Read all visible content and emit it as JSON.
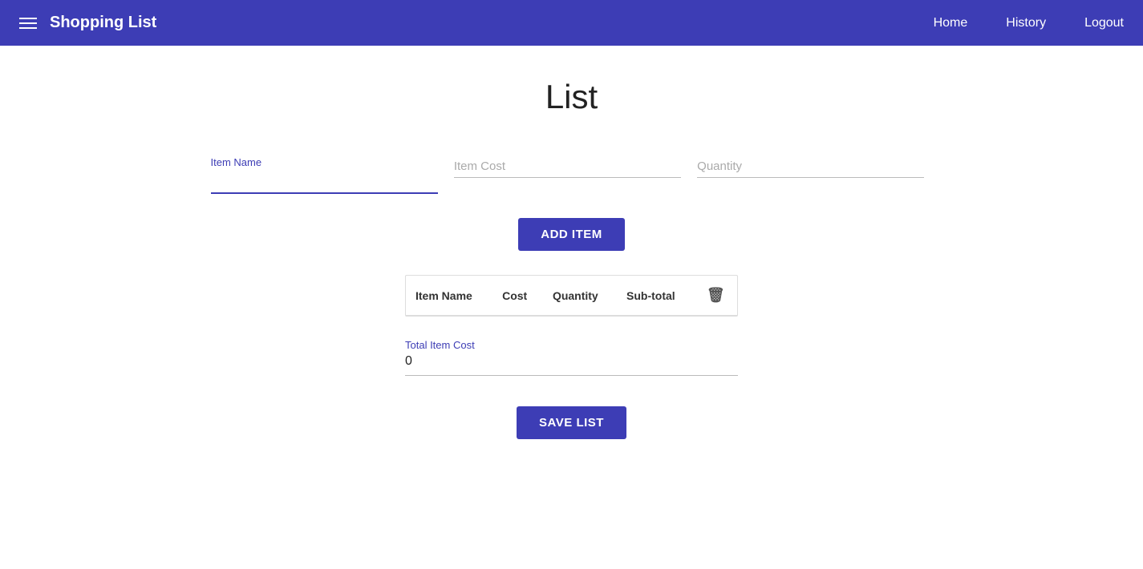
{
  "navbar": {
    "brand": "Shopping List",
    "links": [
      {
        "label": "Home",
        "id": "home"
      },
      {
        "label": "History",
        "id": "history"
      },
      {
        "label": "Logout",
        "id": "logout"
      }
    ]
  },
  "page": {
    "title": "List"
  },
  "form": {
    "item_name_label": "Item Name",
    "item_name_placeholder": "",
    "item_cost_placeholder": "Item Cost",
    "quantity_placeholder": "Quantity",
    "add_item_label": "ADD ITEM"
  },
  "table": {
    "columns": [
      {
        "label": "Item Name",
        "id": "col-item-name"
      },
      {
        "label": "Cost",
        "id": "col-cost"
      },
      {
        "label": "Quantity",
        "id": "col-quantity"
      },
      {
        "label": "Sub-total",
        "id": "col-subtotal"
      }
    ],
    "rows": []
  },
  "total": {
    "label": "Total Item Cost",
    "value": "0"
  },
  "save_list_label": "SAVE LIST",
  "icons": {
    "hamburger": "☰",
    "trash": "🗑"
  }
}
